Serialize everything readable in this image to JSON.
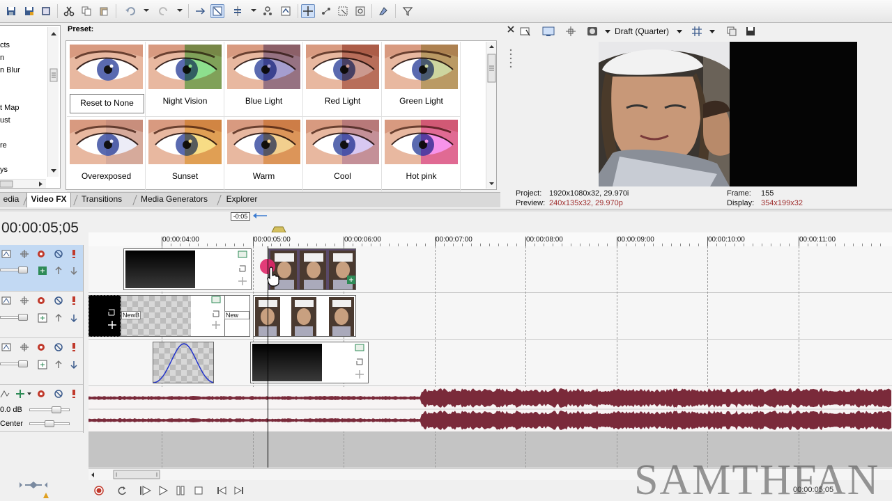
{
  "toolbar": {
    "icons": [
      "save-icon",
      "save-as-icon",
      "render-icon",
      "cut-icon",
      "copy-icon",
      "paste-icon",
      "undo-icon",
      "redo-icon",
      "auto-ripple-icon",
      "normal-edit-icon",
      "snap-icon",
      "lock-envelopes-icon",
      "ignore-grouping-icon",
      "crossfade-icon",
      "zoom-icon",
      "eraser-icon",
      "properties-icon"
    ]
  },
  "fx_list": {
    "items": [
      "cts",
      "n",
      "n Blur",
      "t Map",
      "ust",
      "re",
      "ys"
    ]
  },
  "preset": {
    "label": "Preset:",
    "items": [
      {
        "label": "Reset to None",
        "tint": "#ffffff",
        "selected": true
      },
      {
        "label": "Night Vision",
        "tint": "#2ec42e"
      },
      {
        "label": "Blue Light",
        "tint": "#5b4ea8"
      },
      {
        "label": "Red Light",
        "tint": "#a04432"
      },
      {
        "label": "Green Light",
        "tint": "#a4b450"
      },
      {
        "label": "Overexposed",
        "tint": "#dcdcf0"
      },
      {
        "label": "Sunset",
        "tint": "#f0c020"
      },
      {
        "label": "Warm",
        "tint": "#e8a830"
      },
      {
        "label": "Cool",
        "tint": "#b89ae8"
      },
      {
        "label": "Hot pink",
        "tint": "#f03ad8"
      }
    ]
  },
  "tabs": [
    {
      "label": "edia"
    },
    {
      "label": "Video FX",
      "active": true
    },
    {
      "label": "Transitions"
    },
    {
      "label": "Media Generators"
    },
    {
      "label": "Explorer"
    }
  ],
  "preview": {
    "quality": "Draft (Quarter)",
    "project_label": "Project:",
    "project_value": "1920x1080x32, 29.970i",
    "preview_label": "Preview:",
    "preview_value": "240x135x32, 29.970p",
    "frame_label": "Frame:",
    "frame_value": "155",
    "display_label": "Display:",
    "display_value": "354x199x32"
  },
  "timeline": {
    "timecode": "00:00:05;05",
    "marker_offset": "-0:05",
    "ticks": [
      "00:00:04:00",
      "00:00:05:00",
      "00:00:06:00",
      "00:00:07:00",
      "00:00:08:00",
      "00:00:09:00",
      "00:00:10:00",
      "00:00:11:00"
    ],
    "clip_labels": [
      "NewB",
      "New"
    ],
    "audio_volume": "0.0 dB",
    "audio_pan": "Center",
    "end_time": "00:00:05;05"
  },
  "watermark": "SAMTHFAN",
  "colors": {
    "accent_blue": "#c2d9f3",
    "audio_wave": "#7a2a3a",
    "selection_border": "#6d8fc0"
  }
}
